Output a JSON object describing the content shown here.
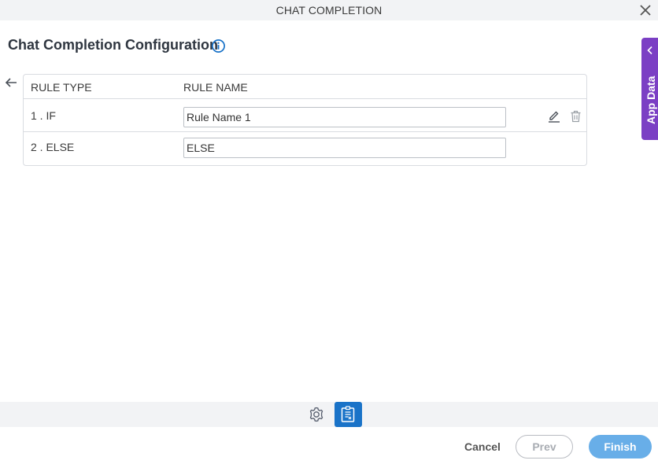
{
  "window": {
    "title": "CHAT COMPLETION"
  },
  "page": {
    "heading": "Chat Completion Configuration"
  },
  "table": {
    "columns": [
      "RULE TYPE",
      "RULE NAME"
    ],
    "rows": [
      {
        "type": "1 . IF",
        "name": "Rule Name 1"
      },
      {
        "type": "2 . ELSE",
        "name": "ELSE"
      }
    ]
  },
  "side_panel": {
    "label": "App Data"
  },
  "footer": {
    "cancel": "Cancel",
    "prev": "Prev",
    "finish": "Finish"
  },
  "icons": {
    "close": "close-icon",
    "info": "info-icon",
    "back": "back-arrow-icon",
    "edit": "pencil-icon",
    "delete": "trash-icon",
    "chevron": "chevron-left-icon",
    "settings": "gear-icon",
    "document": "document-icon"
  },
  "colors": {
    "accent": "#1a73c8",
    "app_data": "#7b3fc4",
    "finish": "#68aee8"
  }
}
